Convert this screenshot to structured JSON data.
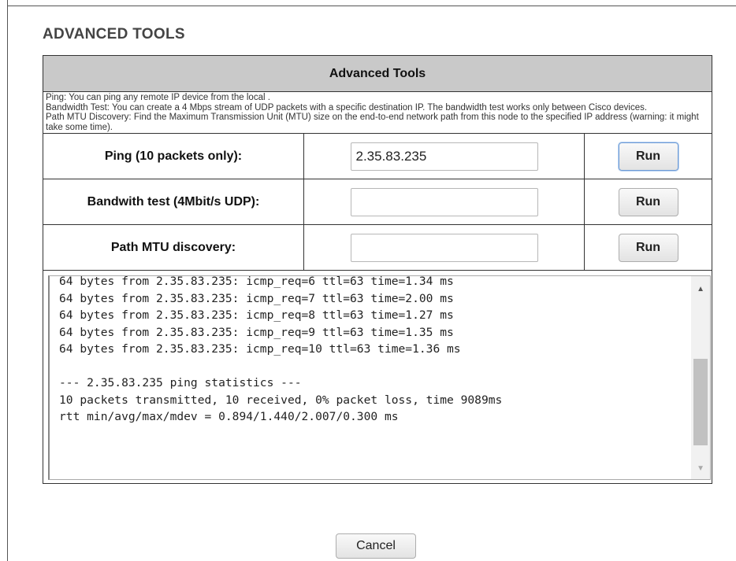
{
  "page": {
    "title": "ADVANCED TOOLS"
  },
  "panel": {
    "header": "Advanced Tools",
    "description": [
      "Ping: You can ping any remote IP device from the local .",
      "Bandwidth Test: You can create a 4 Mbps stream of UDP packets with a specific destination IP. The bandwidth test works only between Cisco devices.",
      "Path MTU Discovery: Find the Maximum Transmission Unit (MTU) size on the end-to-end network path from this node to the specified IP address (warning: it might take some time)."
    ]
  },
  "tools": [
    {
      "label": "Ping (10 packets only):",
      "value": "2.35.83.235",
      "button": "Run"
    },
    {
      "label": "Bandwith test (4Mbit/s UDP):",
      "value": "",
      "button": "Run"
    },
    {
      "label": "Path MTU discovery:",
      "value": "",
      "button": "Run"
    }
  ],
  "output": {
    "lines": [
      "64 bytes from 2.35.83.235: icmp_req=6 ttl=63 time=1.34 ms",
      "64 bytes from 2.35.83.235: icmp_req=7 ttl=63 time=2.00 ms",
      "64 bytes from 2.35.83.235: icmp_req=8 ttl=63 time=1.27 ms",
      "64 bytes from 2.35.83.235: icmp_req=9 ttl=63 time=1.35 ms",
      "64 bytes from 2.35.83.235: icmp_req=10 ttl=63 time=1.36 ms",
      "",
      "--- 2.35.83.235 ping statistics ---",
      "10 packets transmitted, 10 received, 0% packet loss, time 9089ms",
      "rtt min/avg/max/mdev = 0.894/1.440/2.007/0.300 ms"
    ]
  },
  "footer": {
    "cancel_label": "Cancel"
  },
  "icons": {
    "scroll_up": "arrow-up-icon",
    "scroll_down": "arrow-down-icon"
  },
  "colors": {
    "header_bg": "#c9c9c9",
    "border": "#333333",
    "focus": "#6d9bd6"
  }
}
